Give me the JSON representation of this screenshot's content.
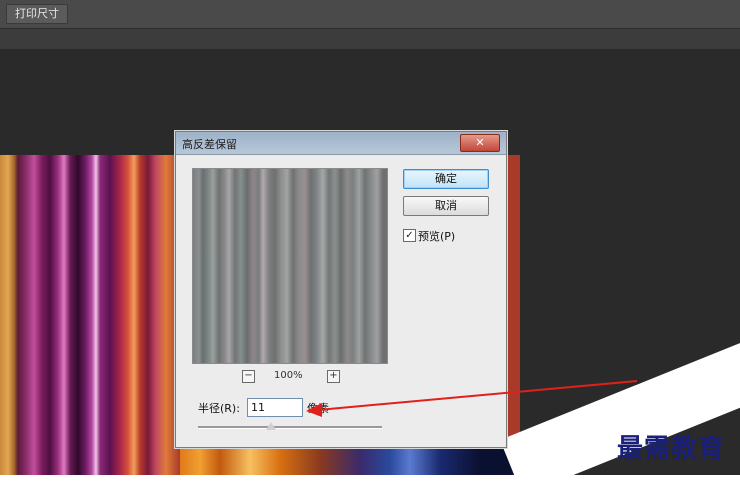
{
  "options_bar": {
    "print_size_label": "打印尺寸"
  },
  "dialog": {
    "title": "高反差保留",
    "close_label": "✕",
    "ok_label": "确定",
    "cancel_label": "取消",
    "preview_checkbox_label": "预览(P)",
    "preview_checked": true,
    "zoom_out_label": "−",
    "zoom_in_label": "+",
    "zoom_level": "100%",
    "radius_label": "半径(R):",
    "radius_value": "11",
    "radius_unit": "像素"
  },
  "annotation": {
    "arrow_color": "#e0201a"
  },
  "watermark": {
    "text": "最需教育"
  }
}
